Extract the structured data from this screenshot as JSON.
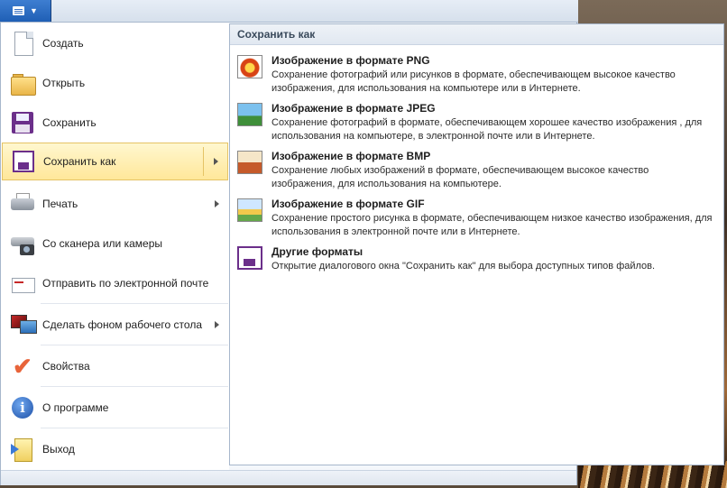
{
  "app_menu": {
    "icon": "document-icon",
    "dropdown_icon": "chevron-down-icon"
  },
  "menu_items": [
    {
      "id": "new",
      "label": "Создать",
      "icon": "new-document-icon",
      "has_submenu": false
    },
    {
      "id": "open",
      "label": "Открыть",
      "icon": "open-folder-icon",
      "has_submenu": false
    },
    {
      "id": "save",
      "label": "Сохранить",
      "icon": "save-icon",
      "has_submenu": false
    },
    {
      "id": "save-as",
      "label": "Сохранить как",
      "icon": "save-as-icon",
      "has_submenu": true,
      "selected": true
    },
    {
      "id": "print",
      "label": "Печать",
      "icon": "printer-icon",
      "has_submenu": true
    },
    {
      "id": "scanner",
      "label": "Со сканера или камеры",
      "icon": "scanner-camera-icon",
      "has_submenu": false
    },
    {
      "id": "email",
      "label": "Отправить по электронной почте",
      "icon": "email-icon",
      "has_submenu": false
    },
    {
      "id": "wallpaper",
      "label": "Сделать фоном рабочего стола",
      "icon": "desktop-background-icon",
      "has_submenu": true
    },
    {
      "id": "properties",
      "label": "Свойства",
      "icon": "checkmark-icon",
      "has_submenu": false
    },
    {
      "id": "about",
      "label": "О программе",
      "icon": "info-icon",
      "has_submenu": false
    },
    {
      "id": "exit",
      "label": "Выход",
      "icon": "exit-icon",
      "has_submenu": false
    }
  ],
  "submenu": {
    "header": "Сохранить как",
    "items": [
      {
        "id": "png",
        "title": "Изображение в формате PNG",
        "description": "Сохранение фотографий или рисунков в формате, обеспечивающем высокое качество изображения, для использования на компьютере или в Интернете.",
        "icon": "png-image-icon"
      },
      {
        "id": "jpeg",
        "title": "Изображение в формате JPEG",
        "description": "Сохранение фотографий в формате, обеспечивающем хорошее качество изображения , для использования на компьютере, в электронной почте или в Интернете.",
        "icon": "jpeg-image-icon"
      },
      {
        "id": "bmp",
        "title": "Изображение в формате BMP",
        "description": "Сохранение любых изображений в формате, обеспечивающем высокое качество изображения, для использования на компьютере.",
        "icon": "bmp-image-icon"
      },
      {
        "id": "gif",
        "title": "Изображение в формате GIF",
        "description": "Сохранение простого рисунка в формате, обеспечивающем низкое качество изображения, для использования в электронной почте или в Интернете.",
        "icon": "gif-image-icon"
      },
      {
        "id": "other",
        "title": "Другие форматы",
        "description": "Открытие диалогового окна \"Сохранить как\" для выбора доступных типов файлов.",
        "icon": "other-formats-icon"
      }
    ]
  },
  "colors": {
    "accent": "#1f5fb5",
    "selection": "#ffe79a",
    "selection_border": "#e5c365"
  }
}
